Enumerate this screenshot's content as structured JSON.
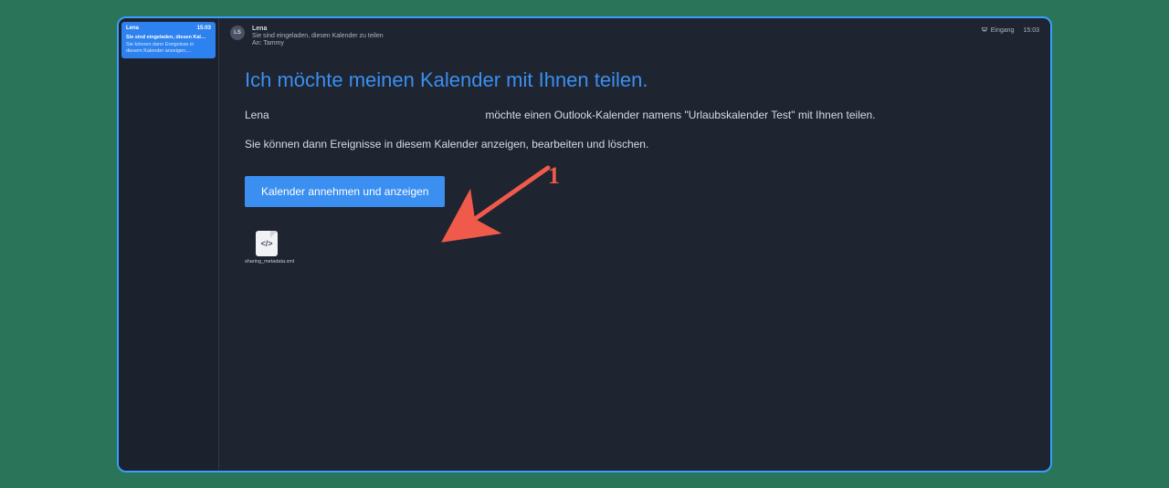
{
  "list": {
    "item": {
      "from": "Lena",
      "time": "15:03",
      "subject": "Sie sind eingeladen, diesen Kal…",
      "preview": "Sie können dann Ereignisse in diesem Kalender anzeigen,…"
    }
  },
  "header": {
    "avatar_initials": "LS",
    "from": "Lena",
    "subject": "Sie sind eingeladen, diesen Kalender zu teilen",
    "to_label": "An:",
    "to_name": "Tammy",
    "folder_label": "Eingang",
    "time": "15:03"
  },
  "body": {
    "title": "Ich möchte meinen Kalender mit Ihnen teilen.",
    "sender_name": "Lena",
    "share_text": "möchte einen Outlook-Kalender namens \"Urlaubskalender Test\" mit Ihnen teilen.",
    "permissions_text": "Sie können dann Ereignisse in diesem Kalender anzeigen, bearbeiten und löschen.",
    "accept_button": "Kalender annehmen und anzeigen"
  },
  "attachment": {
    "icon_glyph": "</>",
    "filename": "sharing_metadata.xml"
  },
  "annotation": {
    "number": "1"
  }
}
